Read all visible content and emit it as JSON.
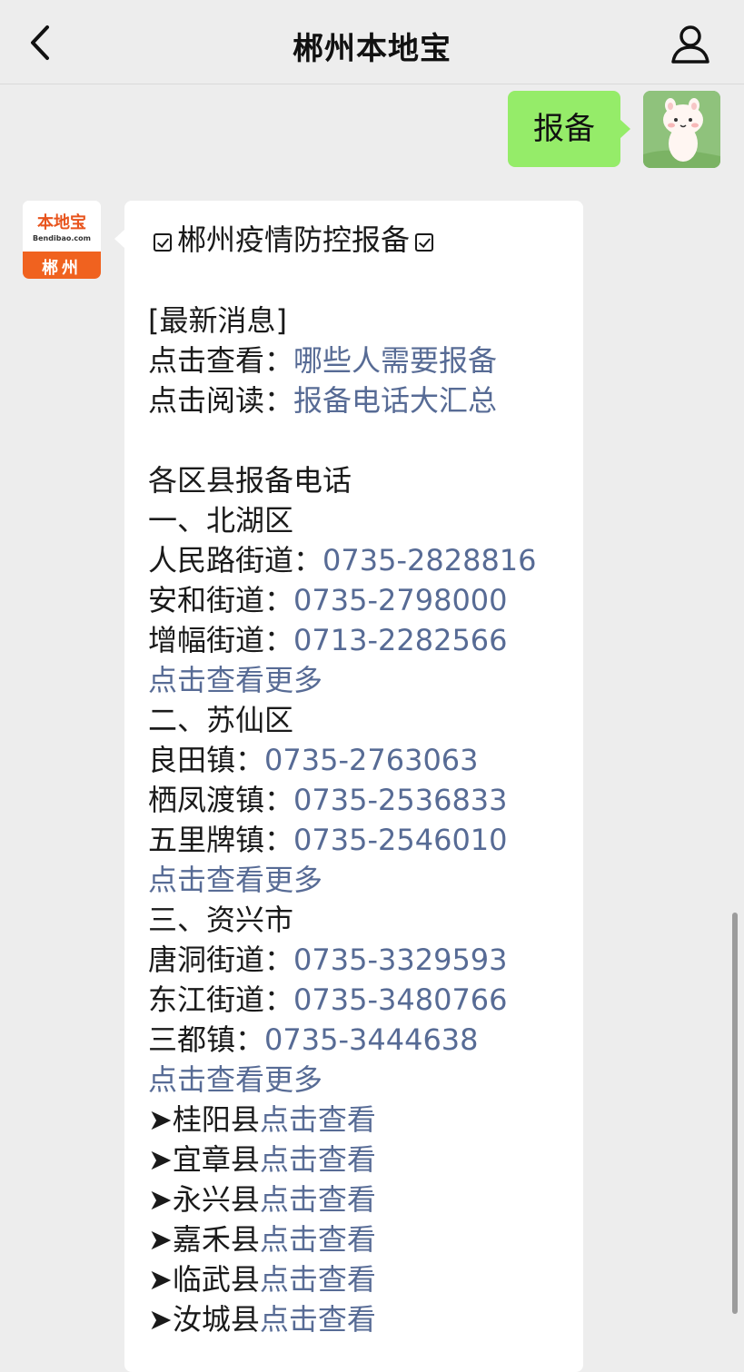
{
  "header": {
    "title": "郴州本地宝",
    "back_icon": "chevron-left-icon",
    "profile_icon": "person-icon"
  },
  "outgoing": {
    "text": "报备",
    "bubble_color": "#95ec69"
  },
  "account": {
    "logo_text": "本地宝",
    "logo_url": "Bendibao.com",
    "city": "郴州",
    "brand_color": "#f0621f"
  },
  "message": {
    "title": "郴州疫情防控报备",
    "latest_news_label": "[最新消息]",
    "news": [
      {
        "prefix": "点击查看：",
        "link": "哪些人需要报备"
      },
      {
        "prefix": "点击阅读：",
        "link": "报备电话大汇总"
      }
    ],
    "section_heading": "各区县报备电话",
    "districts": [
      {
        "name": "一、北湖区",
        "entries": [
          {
            "label": "人民路街道：",
            "phone": "0735-2828816"
          },
          {
            "label": "安和街道：",
            "phone": "0735-2798000"
          },
          {
            "label": "增幅街道：",
            "phone": "0713-2282566"
          }
        ],
        "more": "点击查看更多"
      },
      {
        "name": "二、苏仙区",
        "entries": [
          {
            "label": "良田镇：",
            "phone": "0735-2763063"
          },
          {
            "label": "栖凤渡镇：",
            "phone": "0735-2536833"
          },
          {
            "label": "五里牌镇：",
            "phone": "0735-2546010"
          }
        ],
        "more": "点击查看更多"
      },
      {
        "name": "三、资兴市",
        "entries": [
          {
            "label": "唐洞街道：",
            "phone": "0735-3329593"
          },
          {
            "label": "东江街道：",
            "phone": "0735-3480766"
          },
          {
            "label": "三都镇：",
            "phone": "0735-3444638"
          }
        ],
        "more": "点击查看更多"
      }
    ],
    "counties": [
      {
        "name": "➤桂阳县",
        "link": "点击查看"
      },
      {
        "name": "➤宜章县",
        "link": "点击查看"
      },
      {
        "name": "➤永兴县",
        "link": "点击查看"
      },
      {
        "name": "➤嘉禾县",
        "link": "点击查看"
      },
      {
        "name": "➤临武县",
        "link": "点击查看"
      },
      {
        "name": "➤汝城县",
        "link": "点击查看"
      }
    ],
    "link_color": "#576b95"
  }
}
